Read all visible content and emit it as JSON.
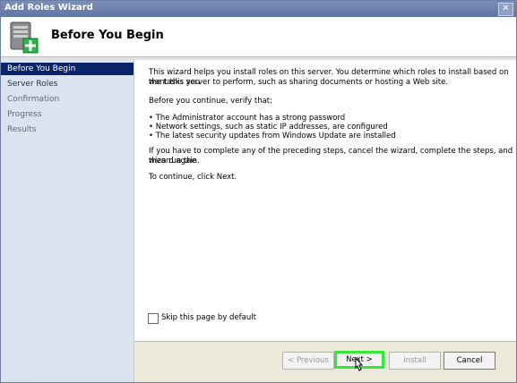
{
  "window": {
    "title": "Add Roles Wizard",
    "close_glyph": "✕"
  },
  "header": {
    "title": "Before You Begin",
    "icon": "server-roles-add-icon"
  },
  "sidebar": {
    "items": [
      {
        "label": "Before You Begin",
        "state": "active"
      },
      {
        "label": "Server Roles",
        "state": "enabled"
      },
      {
        "label": "Confirmation",
        "state": "disabled"
      },
      {
        "label": "Progress",
        "state": "disabled"
      },
      {
        "label": "Results",
        "state": "disabled"
      }
    ]
  },
  "content": {
    "intro_line1": "This wizard helps you install roles on this server. You determine which roles to install based on the tasks you",
    "intro_line2": "want this server to perform, such as sharing documents or hosting a Web site.",
    "verify_heading": "Before you continue, verify that:",
    "bullets": [
      "The Administrator account has a strong password",
      "Network settings, such as static IP addresses, are configured",
      "The latest security updates from Windows Update are installed"
    ],
    "steps_line1": "If you have to complete any of the preceding steps, cancel the wizard, complete the steps, and then run the",
    "steps_line2": "wizard again.",
    "continue_text": "To continue, click Next.",
    "skip_label": "Skip this page by default",
    "skip_checked": false
  },
  "buttons": {
    "previous": "< Previous",
    "next": "Next >",
    "install": "Install",
    "cancel": "Cancel"
  },
  "colors": {
    "highlight": "#34e834",
    "active_nav": "#0a246a",
    "sidebar_bg": "#dbe3ee",
    "titlebar": "#6a7fad"
  }
}
